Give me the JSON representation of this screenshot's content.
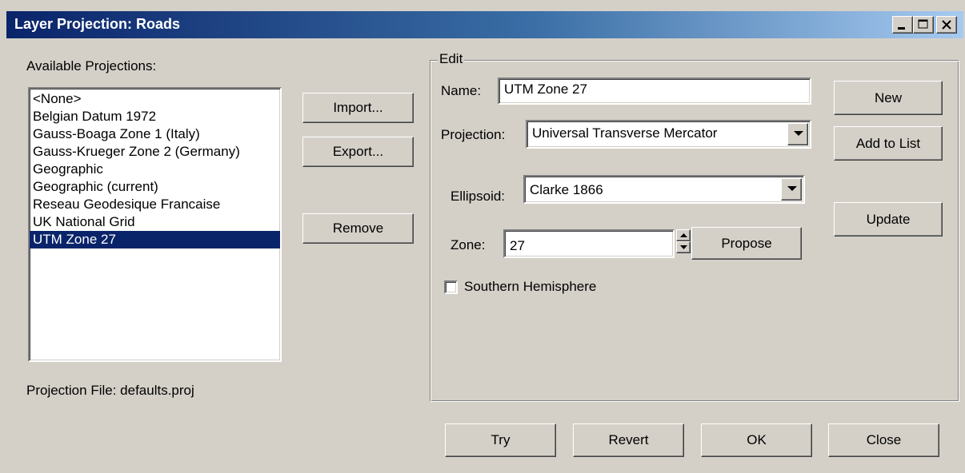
{
  "window": {
    "title": "Layer Projection: Roads",
    "controls": [
      "minimize-icon",
      "maximize-icon",
      "close-icon"
    ]
  },
  "left": {
    "available_label": "Available Projections:",
    "projections": [
      "<None>",
      "Belgian Datum 1972",
      "Gauss-Boaga Zone 1 (Italy)",
      "Gauss-Krueger Zone 2 (Germany)",
      "Geographic",
      "Geographic (current)",
      "Reseau Geodesique Francaise",
      "UK National Grid",
      "UTM Zone 27"
    ],
    "selected": "UTM Zone 27",
    "projection_file": "Projection File: defaults.proj"
  },
  "middle_buttons": {
    "import": "Import...",
    "export": "Export...",
    "remove": "Remove"
  },
  "edit": {
    "legend": "Edit",
    "name_label": "Name:",
    "name_value": "UTM Zone 27",
    "projection_label": "Projection:",
    "projection_value": "Universal Transverse Mercator",
    "ellipsoid_label": "Ellipsoid:",
    "ellipsoid_value": "Clarke 1866",
    "zone_label": "Zone:",
    "zone_value": "27",
    "propose": "Propose",
    "southern_label": "Southern Hemisphere",
    "southern_checked": false
  },
  "right_buttons": {
    "new": "New",
    "add_to_list": "Add to List",
    "update": "Update"
  },
  "bottom_buttons": {
    "try": "Try",
    "revert": "Revert",
    "ok": "OK",
    "close": "Close"
  },
  "colors": {
    "face": "#d4d0c8",
    "title_start": "#0a246a",
    "title_end": "#a6caf0",
    "selection": "#0a246a"
  }
}
